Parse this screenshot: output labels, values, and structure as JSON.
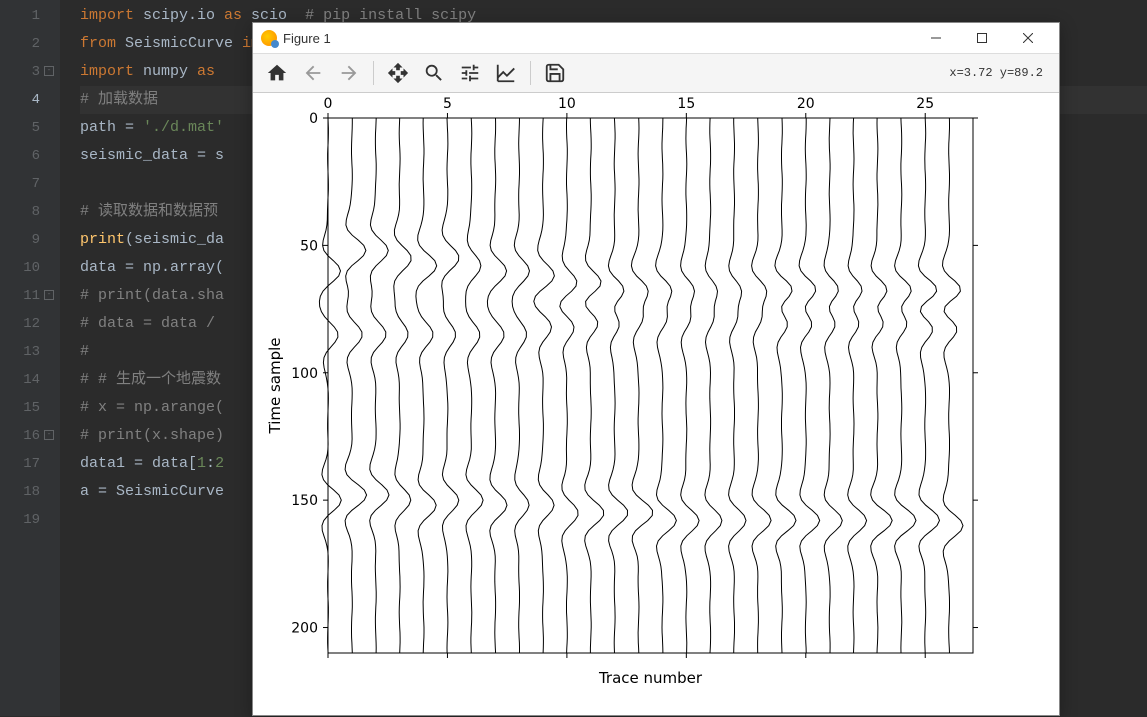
{
  "editor": {
    "lines": [
      {
        "num": "1",
        "html": "<span class='kw'>import</span> scipy.io <span class='kw'>as</span> scio  <span class='cmt'># pip install scipy</span>"
      },
      {
        "num": "2",
        "html": "<span class='kw'>from</span> SeismicCurve <span class='kw'>import</span> SeismicCurve"
      },
      {
        "num": "3",
        "html": "<span class='kw'>import</span> numpy <span class='kw'>as</span>",
        "fold": true
      },
      {
        "num": "4",
        "html": "<span class='cmt'># 加载数据</span>",
        "current": true
      },
      {
        "num": "5",
        "html": "path = <span class='str'>'./d.mat'</span>"
      },
      {
        "num": "6",
        "html": "seismic_data = s"
      },
      {
        "num": "7",
        "html": ""
      },
      {
        "num": "8",
        "html": "<span class='cmt'># 读取数据和数据预</span>"
      },
      {
        "num": "9",
        "html": "<span class='func'>print</span>(seismic_da"
      },
      {
        "num": "10",
        "html": "data = np.array("
      },
      {
        "num": "11",
        "html": "<span class='cmt'># print(data.sha</span>",
        "fold": true
      },
      {
        "num": "12",
        "html": "<span class='cmt'># data = data /</span>"
      },
      {
        "num": "13",
        "html": "<span class='cmt'>#</span>"
      },
      {
        "num": "14",
        "html": "<span class='cmt'># # 生成一个地震数</span>"
      },
      {
        "num": "15",
        "html": "<span class='cmt'># x = np.arange(</span>"
      },
      {
        "num": "16",
        "html": "<span class='cmt'># print(x.shape)</span>",
        "fold": true
      },
      {
        "num": "17",
        "html": "data1 = data[<span class='str'>1</span>:<span class='str'>2</span>"
      },
      {
        "num": "18",
        "html": "a = SeismicCurve"
      },
      {
        "num": "19",
        "html": ""
      }
    ],
    "current_line": 4
  },
  "figure_window": {
    "title": "Figure 1",
    "coords": "x=3.72 y=89.2",
    "toolbar": {
      "home": "Home",
      "back": "Back",
      "forward": "Forward",
      "pan": "Pan",
      "zoom": "Zoom",
      "configure": "Configure",
      "edit": "Edit axis",
      "save": "Save"
    }
  },
  "chart_data": {
    "type": "wiggle",
    "xlabel": "Trace number",
    "ylabel": "Time sample",
    "x_ticks": [
      0,
      5,
      10,
      15,
      20,
      25
    ],
    "y_ticks": [
      0,
      50,
      100,
      150,
      200
    ],
    "x_range": [
      0,
      27
    ],
    "y_range": [
      0,
      210
    ],
    "n_traces": 27,
    "n_samples": 210,
    "events": [
      {
        "trace": 0,
        "times": [
          60,
          85,
          150
        ],
        "amps": [
          0.9,
          0.7,
          0.9
        ]
      },
      {
        "trace": 1,
        "times": [
          52,
          85,
          148
        ],
        "amps": [
          1.0,
          0.7,
          1.0
        ]
      },
      {
        "trace": 2,
        "times": [
          52,
          85,
          148
        ],
        "amps": [
          0.9,
          0.7,
          0.9
        ]
      },
      {
        "trace": 3,
        "times": [
          55,
          85,
          150
        ],
        "amps": [
          0.8,
          0.6,
          0.8
        ]
      },
      {
        "trace": 4,
        "times": [
          58,
          85,
          152
        ],
        "amps": [
          0.9,
          0.7,
          0.9
        ]
      },
      {
        "trace": 5,
        "times": [
          55,
          85,
          150
        ],
        "amps": [
          0.8,
          0.6,
          0.8
        ]
      },
      {
        "trace": 6,
        "times": [
          58,
          85,
          150
        ],
        "amps": [
          0.7,
          0.6,
          0.8
        ]
      },
      {
        "trace": 7,
        "times": [
          60,
          85,
          152
        ],
        "amps": [
          0.8,
          0.6,
          0.8
        ]
      },
      {
        "trace": 8,
        "times": [
          60,
          85,
          152
        ],
        "amps": [
          0.7,
          0.5,
          0.7
        ]
      },
      {
        "trace": 9,
        "times": [
          62,
          82,
          152
        ],
        "amps": [
          0.8,
          0.6,
          0.8
        ]
      },
      {
        "trace": 10,
        "times": [
          65,
          82,
          155
        ],
        "amps": [
          0.8,
          0.6,
          0.8
        ]
      },
      {
        "trace": 11,
        "times": [
          65,
          80,
          155
        ],
        "amps": [
          0.9,
          0.7,
          0.9
        ]
      },
      {
        "trace": 12,
        "times": [
          68,
          80,
          155
        ],
        "amps": [
          0.9,
          0.7,
          0.9
        ]
      },
      {
        "trace": 13,
        "times": [
          68,
          78,
          155
        ],
        "amps": [
          1.0,
          0.8,
          1.0
        ]
      },
      {
        "trace": 14,
        "times": [
          68,
          78,
          158
        ],
        "amps": [
          1.0,
          0.8,
          1.0
        ]
      },
      {
        "trace": 15,
        "times": [
          68,
          78,
          158
        ],
        "amps": [
          0.9,
          0.7,
          0.9
        ]
      },
      {
        "trace": 16,
        "times": [
          68,
          78,
          158
        ],
        "amps": [
          0.8,
          0.6,
          0.8
        ]
      },
      {
        "trace": 17,
        "times": [
          68,
          78,
          158
        ],
        "amps": [
          0.8,
          0.6,
          0.8
        ]
      },
      {
        "trace": 18,
        "times": [
          68,
          78,
          158
        ],
        "amps": [
          0.9,
          0.7,
          0.9
        ]
      },
      {
        "trace": 19,
        "times": [
          68,
          80,
          158
        ],
        "amps": [
          1.0,
          0.8,
          1.0
        ]
      },
      {
        "trace": 20,
        "times": [
          68,
          80,
          158
        ],
        "amps": [
          1.0,
          0.8,
          1.0
        ]
      },
      {
        "trace": 21,
        "times": [
          68,
          80,
          158
        ],
        "amps": [
          0.9,
          0.7,
          0.9
        ]
      },
      {
        "trace": 22,
        "times": [
          68,
          80,
          158
        ],
        "amps": [
          0.9,
          0.7,
          0.9
        ]
      },
      {
        "trace": 23,
        "times": [
          68,
          80,
          158
        ],
        "amps": [
          1.0,
          0.8,
          1.0
        ]
      },
      {
        "trace": 24,
        "times": [
          68,
          80,
          158
        ],
        "amps": [
          1.0,
          0.8,
          1.0
        ]
      },
      {
        "trace": 25,
        "times": [
          68,
          82,
          158
        ],
        "amps": [
          1.0,
          0.8,
          1.0
        ]
      },
      {
        "trace": 26,
        "times": [
          68,
          82,
          160
        ],
        "amps": [
          1.0,
          0.8,
          1.0
        ]
      }
    ]
  }
}
